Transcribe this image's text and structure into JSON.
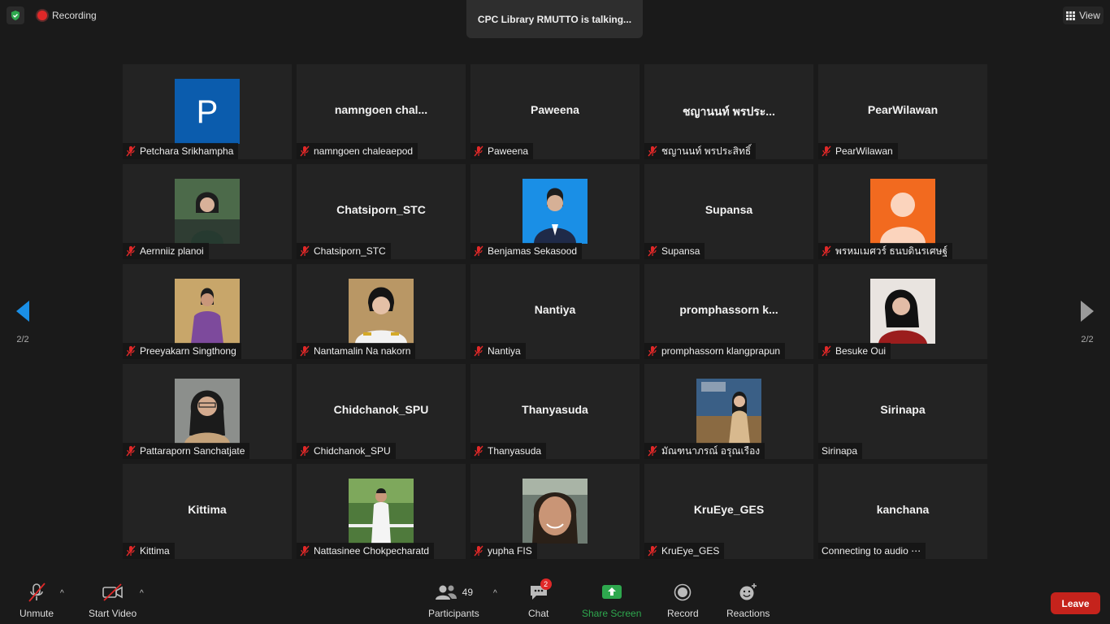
{
  "topbar": {
    "recording_label": "Recording",
    "talking_label": "CPC Library RMUTTO is talking...",
    "view_label": "View"
  },
  "pager": {
    "left_label": "2/2",
    "right_label": "2/2"
  },
  "tiles": [
    {
      "display": "P",
      "name": "Petchara Srikhampha",
      "avatar": "letter-p"
    },
    {
      "display": "namngoen  chal...",
      "name": "namngoen chaleaepod"
    },
    {
      "display": "Paweena",
      "name": "Paweena"
    },
    {
      "display": "ชญานนท์ พรประ...",
      "name": "ชญานนท์ พรประสิทธิ์"
    },
    {
      "display": "PearWilawan",
      "name": "PearWilawan"
    },
    {
      "display": "",
      "name": "Aernniiz planoi",
      "avatar": "photo-green"
    },
    {
      "display": "Chatsiporn_STC",
      "name": "Chatsiporn_STC"
    },
    {
      "display": "",
      "name": "Benjamas Sekasood",
      "avatar": "photo-blue"
    },
    {
      "display": "Supansa",
      "name": "Supansa"
    },
    {
      "display": "",
      "name": "พรหมเมศวร์ ธนบดินรเศษฐ์",
      "avatar": "default-orange"
    },
    {
      "display": "",
      "name": "Preeyakarn Singthong",
      "avatar": "photo-purple"
    },
    {
      "display": "",
      "name": "Nantamalin Na nakorn",
      "avatar": "photo-uniform"
    },
    {
      "display": "Nantiya",
      "name": "Nantiya"
    },
    {
      "display": "promphassorn  k...",
      "name": "promphassorn klangprapun"
    },
    {
      "display": "",
      "name": "Besuke Oui",
      "avatar": "photo-red"
    },
    {
      "display": "",
      "name": "Pattaraporn Sanchatjate",
      "avatar": "photo-gray"
    },
    {
      "display": "Chidchanok_SPU",
      "name": "Chidchanok_SPU"
    },
    {
      "display": "Thanyasuda",
      "name": "Thanyasuda"
    },
    {
      "display": "",
      "name": "มัณฑนาภรณ์ อรุณเรือง",
      "avatar": "photo-art"
    },
    {
      "display": "Sirinapa",
      "name": "Sirinapa",
      "unmuted": true
    },
    {
      "display": "Kittima",
      "name": "Kittima"
    },
    {
      "display": "",
      "name": "Nattasinee Chokpecharatd",
      "avatar": "photo-outdoor"
    },
    {
      "display": "",
      "name": "yupha FIS",
      "avatar": "photo-selfie"
    },
    {
      "display": "KruEye_GES",
      "name": "KruEye_GES"
    },
    {
      "display": "kanchana",
      "name": "Connecting to audio ⋯",
      "unmuted": true
    }
  ],
  "toolbar": {
    "unmute_label": "Unmute",
    "start_video_label": "Start Video",
    "participants_label": "Participants",
    "participants_count": "49",
    "chat_label": "Chat",
    "chat_badge": "2",
    "share_label": "Share Screen",
    "record_label": "Record",
    "reactions_label": "Reactions",
    "leave_label": "Leave"
  },
  "colors": {
    "leave": "#c5231c",
    "share": "#2ea84e",
    "accent_blue": "#1a8fe6",
    "muted_red": "#e02828"
  }
}
